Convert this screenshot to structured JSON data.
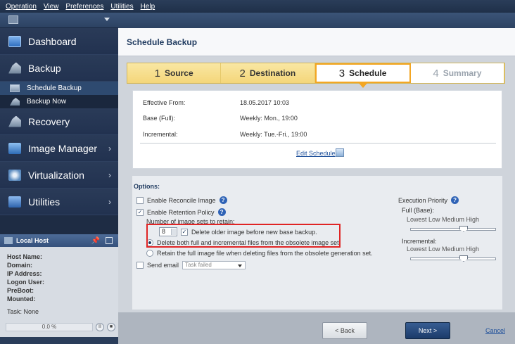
{
  "menu": [
    "Operation",
    "View",
    "Preferences",
    "Utilities",
    "Help"
  ],
  "sidebar": {
    "items": [
      {
        "label": "Dashboard",
        "icon": "dashboard-icon"
      },
      {
        "label": "Backup",
        "icon": "backup-icon"
      },
      {
        "label": "Recovery",
        "icon": "recovery-icon"
      },
      {
        "label": "Image Manager",
        "icon": "image-manager-icon",
        "chevron": "›"
      },
      {
        "label": "Virtualization",
        "icon": "virtualization-icon",
        "chevron": "›"
      },
      {
        "label": "Utilities",
        "icon": "utilities-icon",
        "chevron": "›"
      }
    ],
    "sub_items": [
      {
        "label": "Schedule Backup",
        "icon": "schedule-icon"
      },
      {
        "label": "Backup Now",
        "icon": "backup-now-icon"
      }
    ]
  },
  "host": {
    "title": "Local Host",
    "pin": "📌",
    "fields": [
      "Host Name:",
      "Domain:",
      "IP Address:",
      "Logon User:",
      "PreBoot:",
      "Mounted:"
    ],
    "task": "Task: None",
    "progress": "0.0 %",
    "pause_symbol": "II",
    "stop_symbol": "■"
  },
  "main": {
    "title": "Schedule Backup",
    "steps": [
      {
        "num": "1",
        "label": "Source"
      },
      {
        "num": "2",
        "label": "Destination"
      },
      {
        "num": "3",
        "label": "Schedule"
      },
      {
        "num": "4",
        "label": "Summary"
      }
    ],
    "schedule": {
      "effective_label": "Effective From:",
      "effective_value": "18.05.2017 10:03",
      "base_label": "Base (Full):",
      "base_value": "Weekly: Mon., 19:00",
      "incr_label": "Incremental:",
      "incr_value": "Weekly: Tue.-Fri., 19:00",
      "edit_link": "Edit Schedule"
    },
    "options": {
      "title": "Options:",
      "reconcile": "Enable Reconcile Image",
      "retention": "Enable Retention Policy",
      "retain_label": "Number of image sets to retain:",
      "retain_value": "8",
      "delete_older": "Delete older image before new base backup.",
      "delete_both": "Delete both full and incremental files from the obsolete image set.",
      "retain_full": "Retain the full image file when deleting files from the obsolete generation set.",
      "send_email": "Send email",
      "email_select": "Task failed",
      "check_mark": "✓",
      "help_symbol": "?"
    },
    "priority": {
      "title": "Execution Priority",
      "full_label": "Full (Base):",
      "incr_label": "Incremental:",
      "scale": "Lowest  Low  Medium  High",
      "full_level": "Medium",
      "incr_level": "Medium"
    },
    "footer": {
      "back": "< Back",
      "next": "Next >",
      "cancel": "Cancel"
    }
  }
}
